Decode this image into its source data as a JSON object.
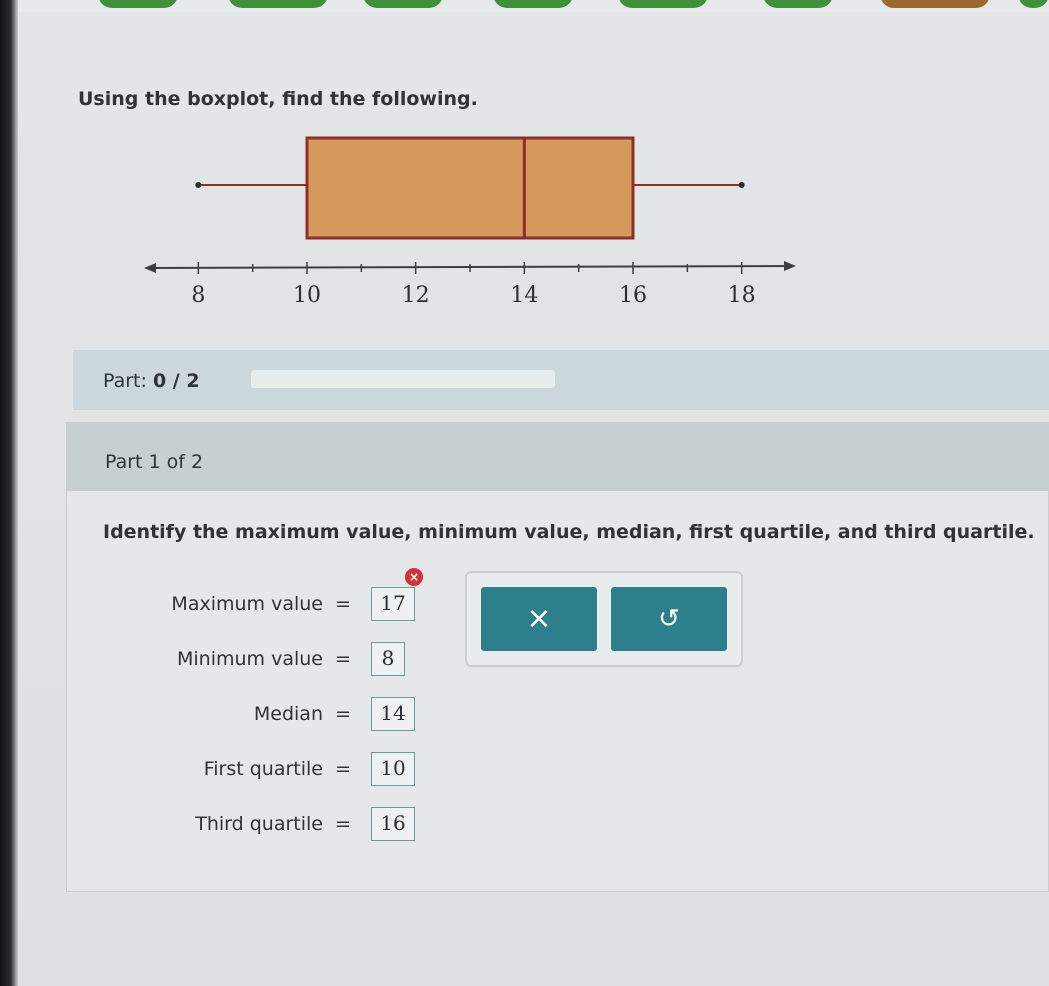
{
  "instruction": "Using the boxplot, find the following.",
  "chart_data": {
    "type": "boxplot",
    "min": 8,
    "q1": 10,
    "median": 14,
    "q3": 16,
    "max": 18,
    "x_ticks": [
      "8",
      "10",
      "12",
      "14",
      "16",
      "18"
    ],
    "xlim": [
      7,
      19
    ],
    "colors": {
      "box_fill": "#d49a5c",
      "box_stroke": "#8f2e2a",
      "whisker": "#8f2e2a"
    }
  },
  "progress": {
    "label": "Part:",
    "value": "0 / 2",
    "fraction": 0
  },
  "part": {
    "header": "Part 1 of 2",
    "question": "Identify the maximum value, minimum value, median, first quartile, and third quartile."
  },
  "answers": [
    {
      "label": "Maximum value",
      "eq": "=",
      "value": "17",
      "status": "incorrect"
    },
    {
      "label": "Minimum value",
      "eq": "=",
      "value": "8",
      "status": ""
    },
    {
      "label": "Median",
      "eq": "=",
      "value": "14",
      "status": ""
    },
    {
      "label": "First quartile",
      "eq": "=",
      "value": "10",
      "status": ""
    },
    {
      "label": "Third quartile",
      "eq": "=",
      "value": "16",
      "status": ""
    }
  ],
  "buttons": {
    "clear_icon": "×",
    "undo_icon": "↺"
  },
  "error_icon": "×"
}
